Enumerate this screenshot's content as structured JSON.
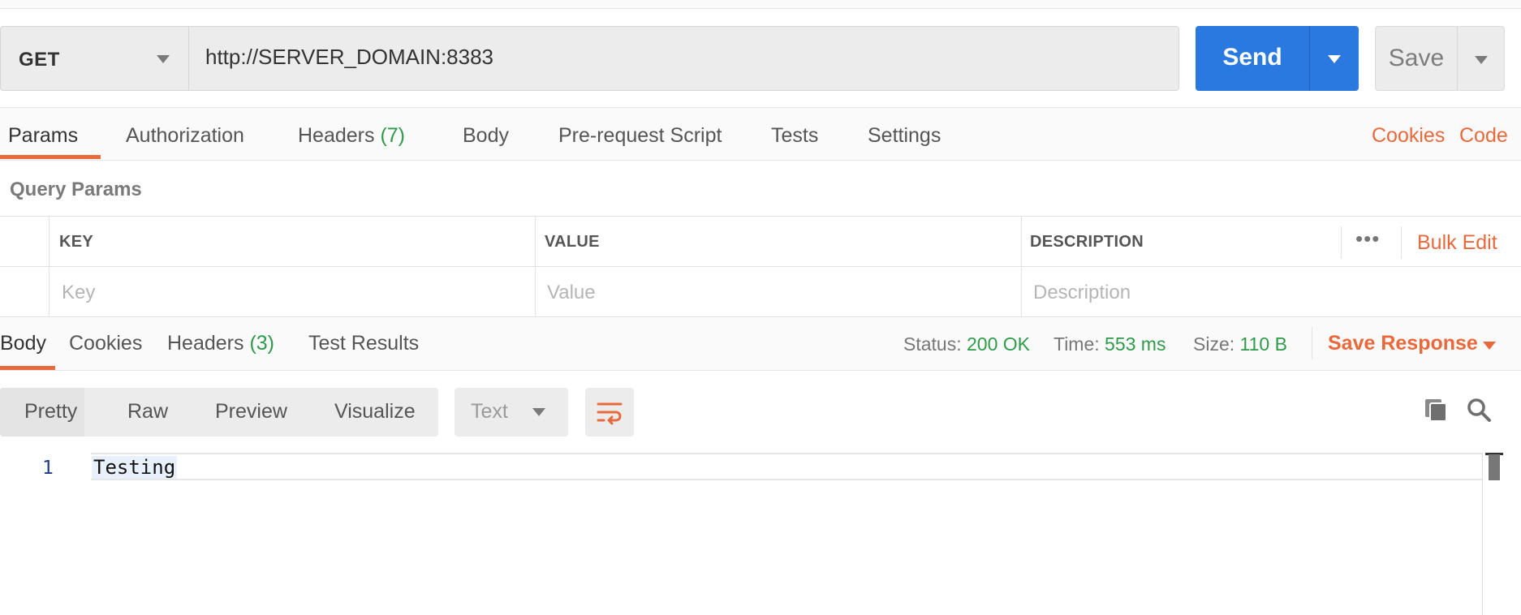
{
  "request": {
    "method": "GET",
    "url": "http://SERVER_DOMAIN:8383",
    "send_label": "Send",
    "save_label": "Save"
  },
  "request_tabs": {
    "params": "Params",
    "authorization": "Authorization",
    "headers": "Headers",
    "headers_count": "(7)",
    "body": "Body",
    "pre_request": "Pre-request Script",
    "tests": "Tests",
    "settings": "Settings",
    "cookies_link": "Cookies",
    "code_link": "Code"
  },
  "query_params": {
    "title": "Query Params",
    "columns": {
      "key": "KEY",
      "value": "VALUE",
      "description": "DESCRIPTION"
    },
    "placeholders": {
      "key": "Key",
      "value": "Value",
      "description": "Description"
    },
    "more": "•••",
    "bulk_edit": "Bulk Edit"
  },
  "response_tabs": {
    "body": "Body",
    "cookies": "Cookies",
    "headers": "Headers",
    "headers_count": "(3)",
    "test_results": "Test Results"
  },
  "response_meta": {
    "status_label": "Status:",
    "status_value": "200 OK",
    "time_label": "Time:",
    "time_value": "553 ms",
    "size_label": "Size:",
    "size_value": "110 B",
    "save_response": "Save Response"
  },
  "view_modes": {
    "pretty": "Pretty",
    "raw": "Raw",
    "preview": "Preview",
    "visualize": "Visualize",
    "format": "Text"
  },
  "response_body": {
    "line_number": "1",
    "content": "Testing"
  },
  "colors": {
    "accent": "#e8693b",
    "send_blue": "#2979e0",
    "success_green": "#2f9a4a"
  }
}
